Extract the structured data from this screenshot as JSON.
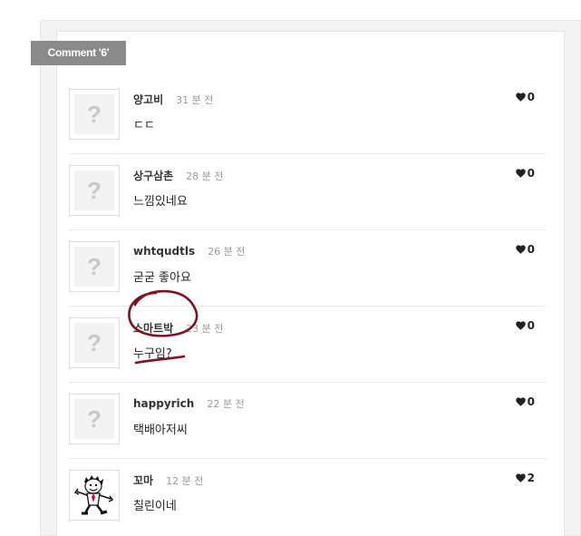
{
  "section_label": "Comment '6'",
  "placeholder_avatar_glyph": "?",
  "like_icon": "heart-icon",
  "annotation_color": "#7b1322",
  "comments": [
    {
      "author": "양고비",
      "time": "31 분 전",
      "text": "ㄷㄷ",
      "likes": "0"
    },
    {
      "author": "상구삼촌",
      "time": "28 분 전",
      "text": "느낌있네요",
      "likes": "0"
    },
    {
      "author": "whtqudtls",
      "time": "26 분 전",
      "text": "굳굳 좋아요",
      "likes": "0"
    },
    {
      "author": "스마트박",
      "time": "23 분 전",
      "text": "누구임?",
      "likes": "0"
    },
    {
      "author": "happyrich",
      "time": "22 분 전",
      "text": "택배아저씨",
      "likes": "0"
    },
    {
      "author": "꼬마",
      "time": "12 분 전",
      "text": "칠린이네",
      "likes": "2"
    }
  ]
}
